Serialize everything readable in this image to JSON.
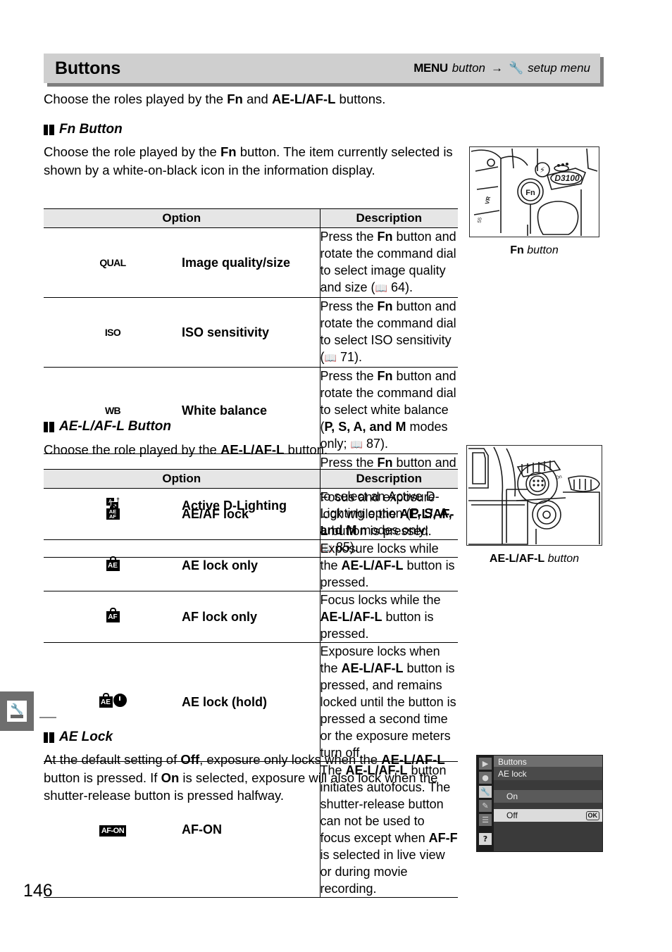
{
  "page": {
    "number": "146"
  },
  "edge_tab": {
    "icon": "setup-menu-wrench-icon"
  },
  "header": {
    "title": "Buttons",
    "breadcrumb": {
      "menu_label": "MENU",
      "button_word": "button",
      "arrow": "→",
      "wrench_icon": "Y",
      "target": "setup menu"
    }
  },
  "intro": {
    "part1": "Choose the roles played by the ",
    "fn": "Fn",
    "part2": " and ",
    "ael": "AE-L/AF-L",
    "part3": " buttons."
  },
  "sections": {
    "fn": {
      "heading": "Fn Button",
      "paragraph_1": "Choose the role played by the ",
      "paragraph_fn": "Fn",
      "paragraph_2": " button.  The item currently selected is shown by a white-on-black icon in the information display."
    },
    "ael": {
      "heading": "AE-L/AF-L Button",
      "paragraph_1": "Choose the role played by the ",
      "paragraph_ael": "AE-L/AF-L",
      "paragraph_2": " button."
    },
    "aelock": {
      "heading": "AE Lock",
      "p1": "At the default setting of ",
      "off": "Off",
      "p2": ", exposure only locks when the ",
      "ael": "AE-L/AF-L",
      "p3": " button is pressed.  If ",
      "on": "On",
      "p4": " is selected, exposure will also lock when the shutter-release button is pressed halfway."
    }
  },
  "table_fn": {
    "headers": {
      "option": "Option",
      "description": "Description"
    },
    "rows": [
      {
        "icon_type": "text",
        "icon": "QUAL",
        "name": "Image quality/size",
        "desc_1": "Press the ",
        "desc_fn": "Fn",
        "desc_2": " button and rotate the command dial to select image quality and size (",
        "page_ref": "64",
        "desc_3": ")."
      },
      {
        "icon_type": "text",
        "icon": "ISO",
        "name": "ISO sensitivity",
        "desc_1": "Press the ",
        "desc_fn": "Fn",
        "desc_2": " button and rotate the command dial to select ISO sensitivity (",
        "page_ref": "71",
        "desc_3": ")."
      },
      {
        "icon_type": "text",
        "icon": "WB",
        "name": "White balance",
        "desc_1": "Press the ",
        "desc_fn": "Fn",
        "desc_2": " button and rotate the command dial to select white balance (",
        "modes": "P, S, A, and M",
        "desc_2b": " modes only; ",
        "page_ref": "87",
        "desc_3": ")."
      },
      {
        "icon_type": "adl",
        "icon": "active-d-lighting-icon",
        "name": "Active D-Lighting",
        "desc_1": "Press the ",
        "desc_fn": "Fn",
        "desc_2": " button and rotate the command dial to select an Active D-Lighting option (",
        "modes": "P, S, A, and M",
        "desc_2b": " modes only; ",
        "page_ref": "85",
        "desc_3": ")."
      }
    ]
  },
  "table_ael": {
    "headers": {
      "option": "Option",
      "description": "Description"
    },
    "rows": [
      {
        "icon_type": "lock2",
        "icon": "ae-af-lock-icon",
        "icon_top": "AE",
        "icon_bottom": "AF",
        "name": "AE/AF lock",
        "desc_1": "Focus and exposure lock while the ",
        "desc_ael": "AE-L/AF-L",
        "desc_2": " button is pressed."
      },
      {
        "icon_type": "lock1",
        "icon": "ae-lock-icon",
        "icon_text": "AE",
        "name": "AE lock only",
        "desc_1": "Exposure locks while the ",
        "desc_ael": "AE-L/AF-L",
        "desc_2": " button is pressed."
      },
      {
        "icon_type": "lock1",
        "icon": "af-lock-icon",
        "icon_text": "AF",
        "name": "AF lock only",
        "desc_1": "Focus locks while the ",
        "desc_ael": "AE-L/AF-L",
        "desc_2": " button is pressed."
      },
      {
        "icon_type": "lockhold",
        "icon": "ae-lock-hold-icon",
        "icon_text": "AE",
        "name": "AE lock (hold)",
        "desc_1": "Exposure locks when the ",
        "desc_ael": "AE-L/AF-L",
        "desc_2": " button is pressed, and remains locked until the button is pressed a second time or the exposure meters turn off."
      },
      {
        "icon_type": "afon",
        "icon": "af-on-icon",
        "icon_text": "AF-ON",
        "name": "AF-ON",
        "desc_0": "The ",
        "desc_ael": "AE-L/AF-L",
        "desc_1": " button initiates autofocus.  The shutter-release button can not be used to focus except when ",
        "desc_aff": "AF-F",
        "desc_2": " is selected in live view or during movie recording."
      }
    ]
  },
  "figures": [
    {
      "name": "fn-button-photo",
      "caption_bold": "Fn",
      "caption_italic": " button",
      "camera_model": "D3100"
    },
    {
      "name": "ael-button-photo",
      "caption_bold": "AE-L/AF-L",
      "caption_italic": " button"
    }
  ],
  "lcd": {
    "title": "Buttons",
    "subtitle": "AE lock",
    "sidebar_icons": [
      "playback-icon",
      "shooting-menu-icon",
      "setup-menu-icon",
      "retouch-menu-icon",
      "recent-settings-icon",
      "help-icon"
    ],
    "sidebar_glyphs": [
      "▶",
      "●",
      "Y",
      "✎",
      "☰",
      "?"
    ],
    "options": [
      {
        "label": "On",
        "selected": false,
        "badge": ""
      },
      {
        "label": "Off",
        "selected": true,
        "badge": "OK"
      }
    ]
  }
}
